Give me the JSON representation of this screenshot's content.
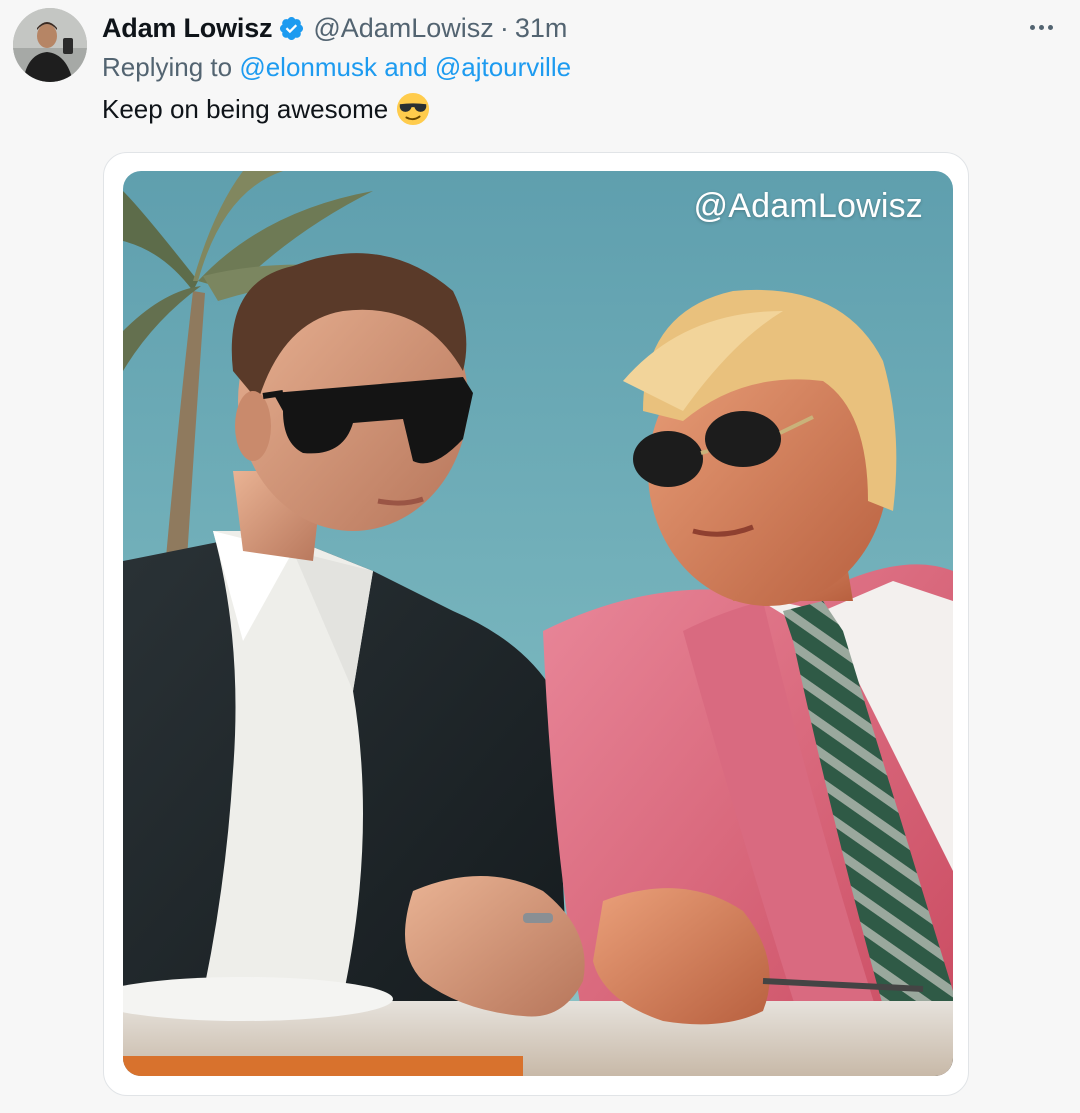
{
  "tweet": {
    "author_name": "Adam Lowisz",
    "author_handle": "@AdamLowisz",
    "separator": "·",
    "timestamp": "31m",
    "verified": true,
    "reply_prefix": "Replying to",
    "reply_user_1": "@elonmusk",
    "reply_conjunction": "and",
    "reply_user_2": "@ajtourville",
    "text": "Keep on being awesome",
    "emoji": "sunglasses-face-emoji"
  },
  "media": {
    "watermark": "@AdamLowisz"
  },
  "icons": {
    "verified": "verified-badge-icon",
    "more": "more-options-icon"
  },
  "colors": {
    "link": "#1d9bf0",
    "secondary_text": "#536471",
    "primary_text": "#0f1419",
    "verified_badge": "#1d9bf0",
    "background": "#f7f7f7"
  }
}
